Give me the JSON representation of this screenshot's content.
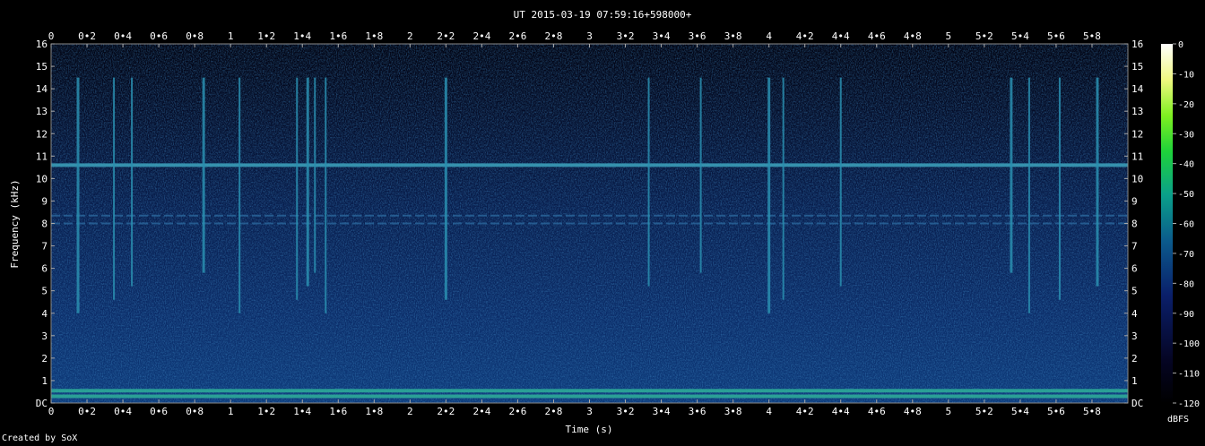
{
  "chart_data": {
    "type": "heatmap",
    "title": "UT 2015-03-19 07:59:16+598000+",
    "xlabel": "Time (s)",
    "ylabel": "Frequency (kHz)",
    "xlim": [
      0,
      6
    ],
    "ylim": [
      0,
      16
    ],
    "x_ticks": [
      "0",
      "0•2",
      "0•4",
      "0•6",
      "0•8",
      "1",
      "1•2",
      "1•4",
      "1•6",
      "1•8",
      "2",
      "2•2",
      "2•4",
      "2•6",
      "2•8",
      "3",
      "3•2",
      "3•4",
      "3•6",
      "3•8",
      "4",
      "4•2",
      "4•4",
      "4•6",
      "4•8",
      "5",
      "5•2",
      "5•4",
      "5•6",
      "5•8"
    ],
    "y_ticks": [
      "DC",
      "1",
      "2",
      "3",
      "4",
      "5",
      "6",
      "7",
      "8",
      "9",
      "10",
      "11",
      "12",
      "13",
      "14",
      "15",
      "16"
    ],
    "colorbar": {
      "label": "dBFS",
      "ticks": [
        "0",
        "-10",
        "-20",
        "-30",
        "-40",
        "-50",
        "-60",
        "-70",
        "-80",
        "-90",
        "-100",
        "-110",
        "-120"
      ],
      "range": [
        -120,
        0
      ]
    },
    "features": {
      "constant_tones_khz": [
        10.6,
        8.35,
        8.0,
        0.55,
        0.3
      ],
      "broadband_bursts_s": [
        0.15,
        0.35,
        0.45,
        0.85,
        1.05,
        1.37,
        1.43,
        1.47,
        1.53,
        2.2,
        3.33,
        3.62,
        4.0,
        4.08,
        4.4,
        5.35,
        5.45,
        5.62,
        5.83
      ]
    }
  },
  "credit": "Created by SoX"
}
